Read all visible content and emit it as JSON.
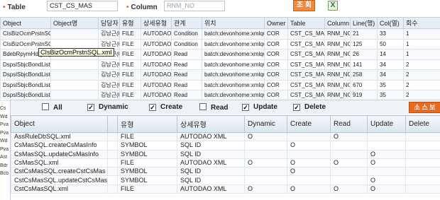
{
  "search": {
    "table_label": "Table",
    "table_value": "CST_CS_MAS",
    "column_label": "Column",
    "column_placeholder": "RNM_NO",
    "search_button": "조 회",
    "excel_button": "X"
  },
  "upper_grid": {
    "columns": [
      "Object",
      "Object명",
      "담당자",
      "유형",
      "상세유형",
      "관계",
      "위치",
      "Owner",
      "Table",
      "Column",
      "Line(행)",
      "Col(열)",
      "회수"
    ],
    "rows": [
      [
        "CIsBizOcmPrstnSQL.xml",
        "",
        "김남근(0",
        "FILE",
        "AUTODAO",
        "Condition",
        "batch:devonhome:xmlquery",
        "COR",
        "CST_CS_MAS",
        "RNM_NO",
        "21",
        "33",
        "1"
      ],
      [
        "CIsBizOcmPrstnSQL.xml",
        "",
        "김남근(0",
        "FILE",
        "AUTODAO",
        "Condition",
        "batch:devonhome:xmlquery",
        "COR",
        "CST_CS_MAS",
        "RNM_NO",
        "125",
        "50",
        "1"
      ],
      [
        "BdebRpymHdlgSQL.xml",
        "",
        "김남근(0",
        "FILE",
        "AUTODAO",
        "Read",
        "batch:devonhome:xmlquery",
        "COR",
        "CST_CS_MAS",
        "RNM_NO",
        "26",
        "14",
        "1"
      ],
      [
        "DspslSbjcBondListSQL.xml",
        "",
        "김남근(0",
        "FILE",
        "AUTODAO",
        "Read",
        "batch:devonhome:xmlquery",
        "COR",
        "CST_CS_MAS",
        "RNM_NO",
        "141",
        "34",
        "2"
      ],
      [
        "DspslSbjcBondListSQL.xml",
        "",
        "김남근(0",
        "FILE",
        "AUTODAO",
        "Read",
        "batch:devonhome:xmlquery",
        "COR",
        "CST_CS_MAS",
        "RNM_NO",
        "258",
        "34",
        "2"
      ],
      [
        "DspslSbjcBondListSQL.xml",
        "",
        "김남근(0",
        "FILE",
        "AUTODAO",
        "Read",
        "batch:devonhome:xmlquery",
        "COR",
        "CST_CS_MAS",
        "RNM_NO",
        "670",
        "35",
        "2"
      ],
      [
        "DspslSbjcBondListSQL.xml",
        "",
        "김남근(0",
        "FILE",
        "AUTODAO",
        "Read",
        "batch:devonhome:xmlquery",
        "COR",
        "CST_CS_MAS",
        "RNM_NO",
        "919",
        "35",
        "2"
      ]
    ],
    "tooltip": "CIsBizOcmPrstnSQL.xml"
  },
  "left_column": [
    "Cs",
    "Wd",
    "Pva",
    "Pva",
    "Wd",
    "Pva",
    "Ast",
    "Bdr",
    "Bcb"
  ],
  "filters": {
    "all": {
      "label": "All",
      "checked": ""
    },
    "dynamic": {
      "label": "Dynamic",
      "checked": "✓"
    },
    "create": {
      "label": "Create",
      "checked": "✓"
    },
    "read": {
      "label": "Read",
      "checked": ""
    },
    "update": {
      "label": "Update",
      "checked": "✓"
    },
    "delete": {
      "label": "Delete",
      "checked": "✓"
    },
    "source_button": "소 스 보"
  },
  "lower_grid": {
    "columns": [
      "Object",
      "",
      "유형",
      "상세유형",
      "Dynamic",
      "Create",
      "Read",
      "Update",
      "Delete"
    ],
    "rows": [
      [
        "AssRuleDbSQL.xml",
        "",
        "FILE",
        "AUTODAO XML",
        "O",
        "",
        "O",
        "",
        ""
      ],
      [
        "CsMasSQL.createCsMasInfo",
        "",
        "SYMBOL",
        "SQL ID",
        "",
        "O",
        "",
        "",
        ""
      ],
      [
        "CsMasSQL.updateCsMasInfo",
        "",
        "SYMBOL",
        "SQL ID",
        "",
        "",
        "",
        "O",
        ""
      ],
      [
        "CsMasSQL.xml",
        "",
        "FILE",
        "AUTODAO XML",
        "O",
        "O",
        "O",
        "O",
        ""
      ],
      [
        "CstCsMasSQL.createCstCsMas",
        "",
        "SYMBOL",
        "SQL ID",
        "",
        "O",
        "",
        "",
        ""
      ],
      [
        "CstCsMasSQL.updateCstCsMas",
        "",
        "SYMBOL",
        "SQL ID",
        "",
        "",
        "",
        "O",
        ""
      ],
      [
        "CstCsMasSQL.xml",
        "",
        "FILE",
        "AUTODAO XML",
        "O",
        "O",
        "O",
        "O",
        ""
      ]
    ]
  },
  "colors": {
    "accent_orange": "#f28a3c",
    "header_blue": "#e6edf5",
    "grid_border": "#c5d0dc"
  }
}
